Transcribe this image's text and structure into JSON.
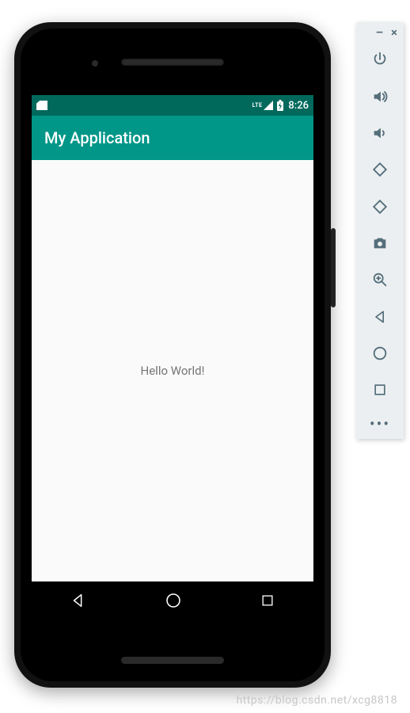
{
  "status_bar": {
    "network_label": "LTE",
    "time": "8:26"
  },
  "app_bar": {
    "title": "My Application"
  },
  "content": {
    "hello_text": "Hello World!"
  },
  "emulator_panel": {
    "minimize_label": "–",
    "close_label": "×",
    "more_label": "•••",
    "buttons": [
      {
        "name": "power-icon"
      },
      {
        "name": "volume-up-icon"
      },
      {
        "name": "volume-down-icon"
      },
      {
        "name": "rotate-left-icon"
      },
      {
        "name": "rotate-right-icon"
      },
      {
        "name": "camera-icon"
      },
      {
        "name": "zoom-icon"
      },
      {
        "name": "back-icon"
      },
      {
        "name": "home-icon"
      },
      {
        "name": "overview-icon"
      }
    ]
  },
  "watermark": "https://blog.csdn.net/xcg8818"
}
